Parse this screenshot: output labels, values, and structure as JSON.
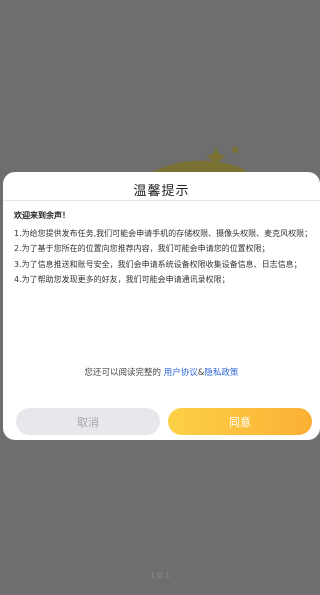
{
  "dialog": {
    "title": "温馨提示",
    "greeting": "欢迎来到余声！",
    "items": [
      "1.为给您提供发布任务,我们可能会申请手机的存储权限、摄像头权限、麦克风权限；",
      "2.为了基于您所在的位置向您推荐内容，我们可能会申请您的位置权限；",
      "3.为了信息推送和账号安全，我们会申请系统设备权限收集设备信息、日志信息；",
      "4.为了帮助您发现更多的好友，我们可能会申请通讯录权限；"
    ],
    "read_prefix": "您还可以阅读完整的",
    "user_agreement": "用户协议",
    "amp": "&",
    "privacy_policy": "隐私政策",
    "cancel_label": "取消",
    "agree_label": "同意"
  },
  "footer": {
    "version": "1.0.1"
  },
  "colors": {
    "accent_yellow": "#fcd146",
    "accent_orange": "#fbb034",
    "link_blue": "#2f66d8",
    "overlay": "#6e6e6e"
  },
  "icons": {
    "splash": "brand-logo-icon"
  }
}
